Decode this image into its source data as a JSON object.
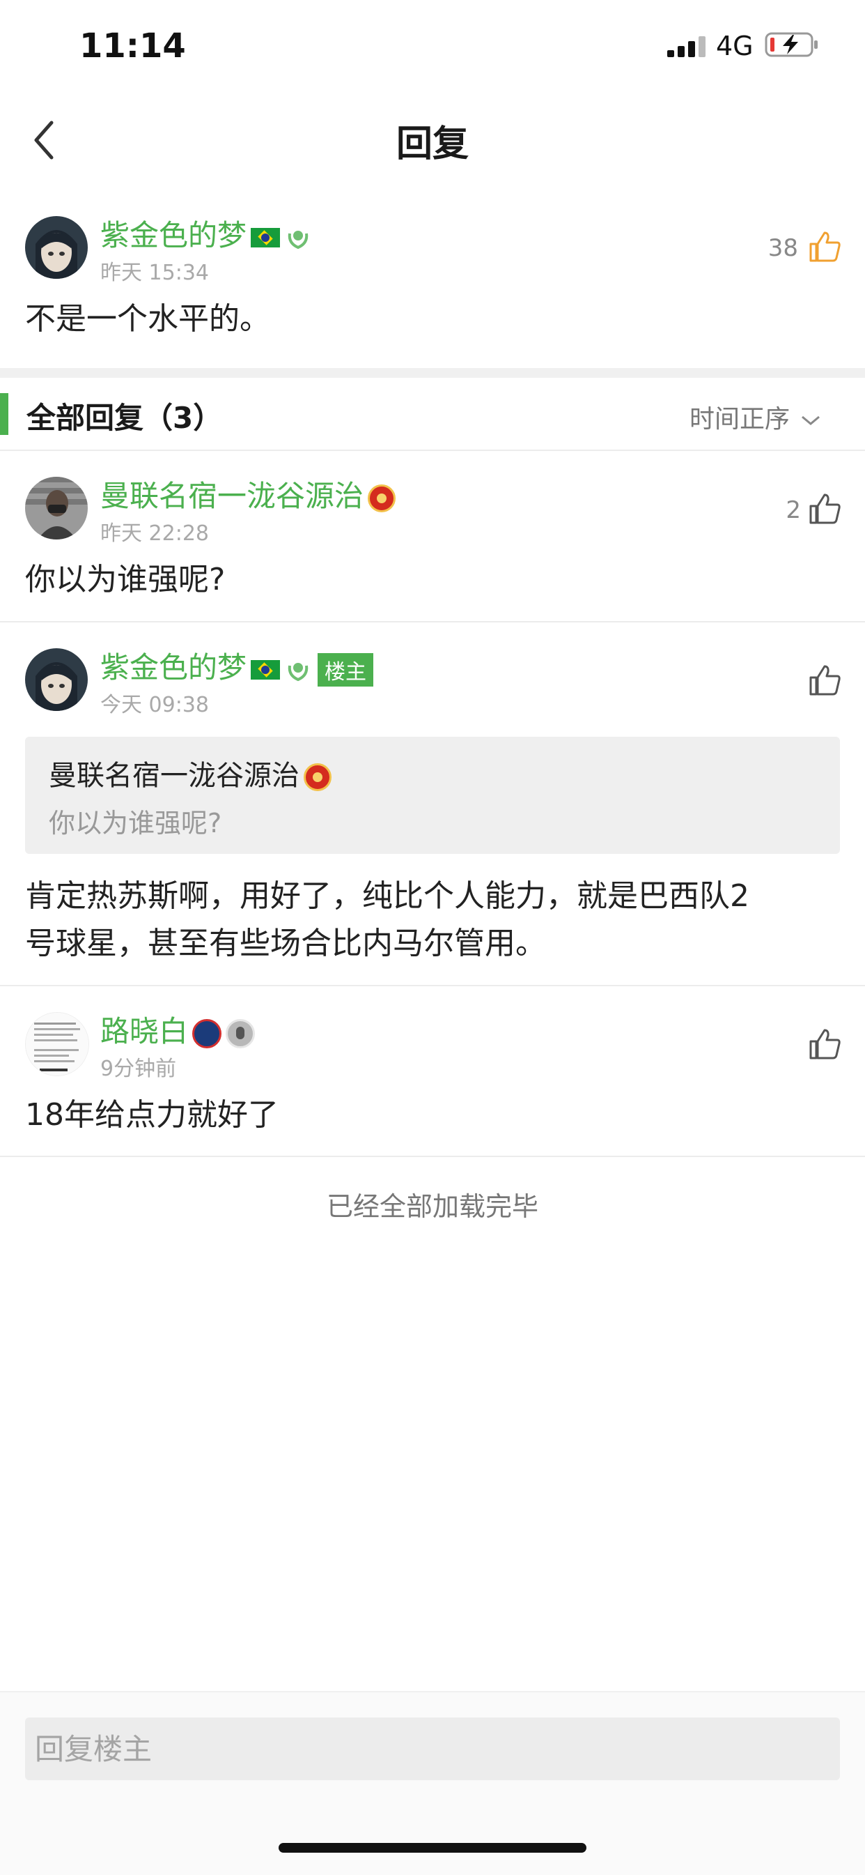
{
  "status_bar": {
    "time": "11:14",
    "network": "4G"
  },
  "nav": {
    "title": "回复"
  },
  "main_post": {
    "username": "紫金色的梦",
    "time": "昨天 15:34",
    "likes": "38",
    "content": "不是一个水平的。"
  },
  "section": {
    "title": "全部回复（3）",
    "sort_label": "时间正序"
  },
  "replies": [
    {
      "username": "曼联名宿一泷谷源治",
      "time": "昨天 22:28",
      "likes": "2",
      "content": "你以为谁强呢?"
    },
    {
      "username": "紫金色的梦",
      "owner_tag": "楼主",
      "time": "今天 09:38",
      "quote_name": "曼联名宿一泷谷源治",
      "quote_text": "你以为谁强呢?",
      "content_line1": "肯定热苏斯啊，用好了，纯比个人能力，就是巴西队2",
      "content_line2": "号球星，甚至有些场合比内马尔管用。"
    },
    {
      "username": "路晓白",
      "time": "9分钟前",
      "content": "18年给点力就好了"
    }
  ],
  "footer": {
    "end_text": "已经全部加载完毕"
  },
  "reply_bar": {
    "placeholder": "回复楼主"
  },
  "colors": {
    "accent": "#4bb04e",
    "like_active": "#f0a030",
    "text": "#222222",
    "muted": "#a9a9a9"
  }
}
